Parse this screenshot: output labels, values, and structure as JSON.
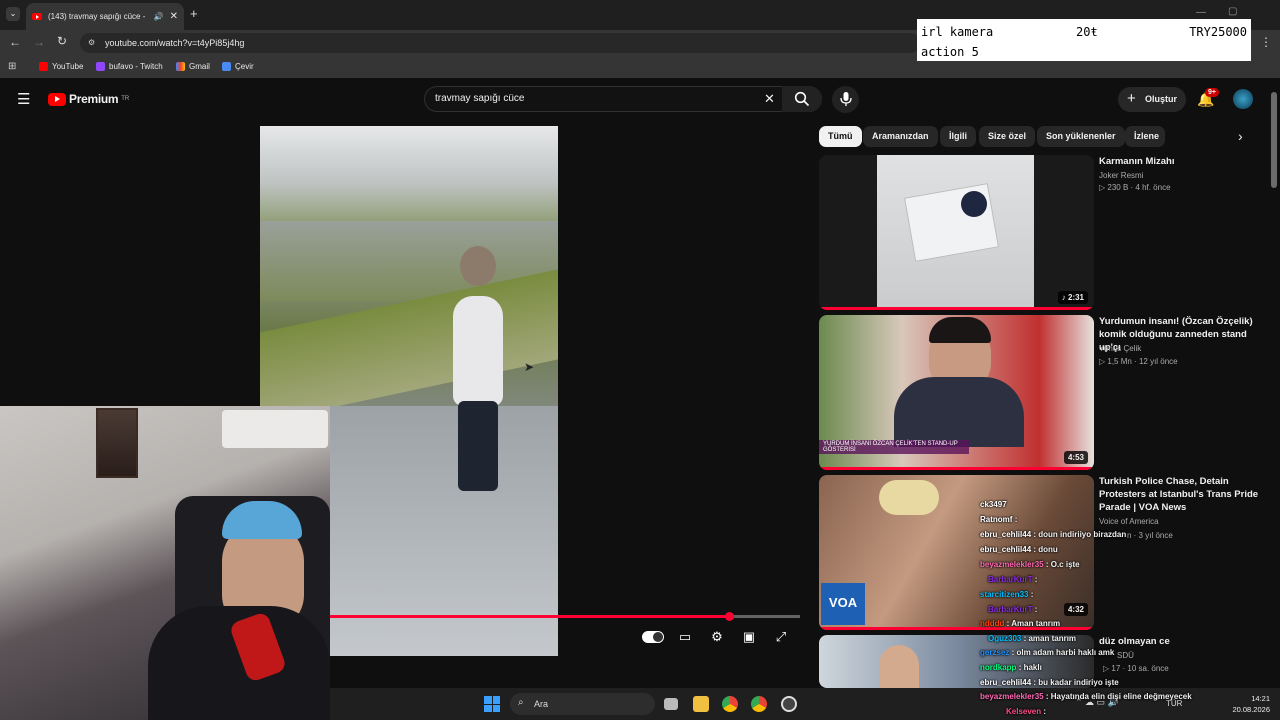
{
  "browser": {
    "tab_title": "(143) travmay sapığı cüce -",
    "url": "youtube.com/watch?v=t4yPi85j4hg",
    "bookmarks": [
      "YouTube",
      "bufavo - Twitch",
      "Gmail",
      "Çevir"
    ]
  },
  "donation_card": {
    "line1_left": "irl kamera",
    "line1_mid": "20ŧ",
    "line1_right": "TRY25000",
    "line2": "action 5"
  },
  "youtube": {
    "logo": "Premium",
    "logo_region": "TR",
    "search_value": "travmay sapığı cüce",
    "create_label": "Oluştur",
    "notif_count": "9+"
  },
  "chips": [
    "Tümü",
    "Aramanızdan",
    "İlgili",
    "Size özel",
    "Son yüklenenler",
    "İzlene"
  ],
  "recommendations": [
    {
      "title": "Karmanın Mizahı",
      "channel": "Joker Resmi",
      "meta": "▷ 230 B · 4 hf. önce",
      "duration": "♪ 2:31"
    },
    {
      "title": "Yurdumun insanı! (Özcan Özçelik) komik olduğunu zanneden stand up'çı",
      "channel": "Yunus Çelik",
      "meta": "▷ 1,5 Mn · 12 yıl önce",
      "duration": "4:53"
    },
    {
      "title": "Turkish Police Chase, Detain Protesters at Istanbul's Trans Pride Parade | VOA News",
      "channel": "Voice of America",
      "meta": "n · 3 yıl önce",
      "duration": "4:32"
    },
    {
      "title": "düz olmayan ce",
      "channel": "SDÜ",
      "meta": "▷ 17 · 10 sa. önce",
      "duration": ""
    }
  ],
  "thumb_captions": {
    "yurdum": "YURDUM İNSANI ÖZCAN ÇELİK'TEN STAND-UP GÖSTERİSİ",
    "voa": "VOA"
  },
  "chat": [
    {
      "user": "ck3497",
      "msg": "",
      "color": "#ffffff"
    },
    {
      "user": "Ratnomf",
      "msg": ":",
      "color": "#ffffff"
    },
    {
      "user": "ebru_cehlil44",
      "msg": ": doun indiriiyo birazdan",
      "color": "#ffffff"
    },
    {
      "user": "ebru_cehlil44",
      "msg": ": donu",
      "color": "#ffffff"
    },
    {
      "user": "beyazmelekler35",
      "msg": ": O.c işte",
      "color": "#ff69b4"
    },
    {
      "user": "BarbarKurT",
      "msg": ":",
      "color": "#8a2be2"
    },
    {
      "user": "starcitizen33",
      "msg": ":",
      "color": "#00bfff"
    },
    {
      "user": "BarbarKurT",
      "msg": ":",
      "color": "#8a2be2"
    },
    {
      "user": "ndddd",
      "msg": ": Aman tanrım",
      "color": "#ff4500"
    },
    {
      "user": "Oguz303",
      "msg": ": aman tanrım",
      "color": "#00bfff"
    },
    {
      "user": "gerzsez",
      "msg": ": olm adam harbi haklı amk",
      "color": "#1e90ff"
    },
    {
      "user": "nordkapp",
      "msg": ": haklı",
      "color": "#00ff7f"
    },
    {
      "user": "ebru_cehlil44",
      "msg": ": bu kadar indiriyo işte",
      "color": "#ffffff"
    },
    {
      "user": "beyazmelekler35",
      "msg": ": Hayatında elin dişi eline değmeyecek",
      "color": "#ff69b4"
    },
    {
      "user": "Kelseven",
      "msg": ":",
      "color": "#ff4d88"
    }
  ],
  "taskbar": {
    "search_label": "Ara",
    "lang": "TÜR",
    "time": "14:21",
    "date": "20.08.2026"
  }
}
